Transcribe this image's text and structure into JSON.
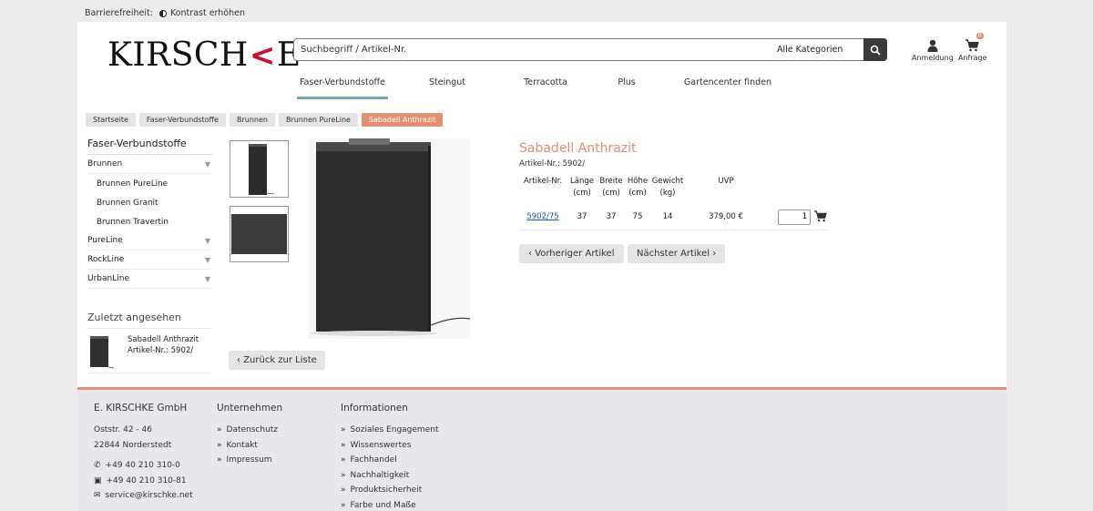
{
  "accessibility": {
    "label": "Barrierefreiheit:",
    "contrast": "Kontrast erhöhen"
  },
  "brand": {
    "part1": "KIRSCH",
    "mark": "<",
    "part2": "E"
  },
  "search": {
    "placeholder": "Suchbegriff / Artikel-Nr.",
    "category": "Alle Kategorien"
  },
  "account": {
    "login": "Anmeldung",
    "cart": "Anfrage",
    "cart_count": "0"
  },
  "nav": [
    {
      "label": "Faser-Verbundstoffe"
    },
    {
      "label": "Steingut"
    },
    {
      "label": "Terracotta"
    },
    {
      "label": "Plus"
    },
    {
      "label": "Gartencenter finden"
    }
  ],
  "breadcrumb": [
    "Startseite",
    "Faser-Verbundstoffe",
    "Brunnen",
    "Brunnen PureLine",
    "Sabadell Anthrazit"
  ],
  "sidebar": {
    "title": "Faser-Verbundstoffe",
    "brunnen": "Brunnen",
    "sub": [
      "Brunnen PureLine",
      "Brunnen Granit",
      "Brunnen Travertin"
    ],
    "pureline": "PureLine",
    "rockline": "RockLine",
    "urbanline": "UrbanLine"
  },
  "recent": {
    "title": "Zuletzt angesehen",
    "name": "Sabadell Anthrazit",
    "art": "Artikel-Nr.: 5902/"
  },
  "gallery": {
    "back": "Zurück zur Liste"
  },
  "product": {
    "title": "Sabadell Anthrazit",
    "art": "Artikel-Nr.: 5902/",
    "headers": [
      "Artikel-Nr.",
      "Länge\n(cm)",
      "Breite\n(cm)",
      "Höhe\n(cm)",
      "Gewicht\n(kg)",
      "UVP"
    ],
    "h_art": "Artikel-Nr.",
    "h_len1": "Länge",
    "h_len2": "(cm)",
    "h_wid1": "Breite",
    "h_wid2": "(cm)",
    "h_hei1": "Höhe",
    "h_hei2": "(cm)",
    "h_wei1": "Gewicht",
    "h_wei2": "(kg)",
    "h_uvp": "UVP",
    "row": {
      "art": "5902/75",
      "len": "37",
      "wid": "37",
      "hei": "75",
      "wei": "14",
      "uvp": "379,00 €",
      "qty": "1"
    },
    "prev": "Vorheriger Artikel",
    "next": "Nächster Artikel"
  },
  "footer": {
    "company": "E. KIRSCHKE GmbH",
    "street": "Oststr. 42 - 46",
    "city": "22844 Norderstedt",
    "phone": "+49 40 210 310-0",
    "fax": "+49 40 210 310-81",
    "email": "service@kirschke.net",
    "col2_title": "Unternehmen",
    "col2": [
      "Datenschutz",
      "Kontakt",
      "Impressum"
    ],
    "col3_title": "Informationen",
    "col3": [
      "Soziales Engagement",
      "Wissenswertes",
      "Fachhandel",
      "Nachhaltigkeit",
      "Produktsicherheit",
      "Farbe und Maße"
    ]
  },
  "colors": {
    "accent": "#e38f74",
    "nav_underline": "#7ba4b6",
    "dark": "#3a3a3a"
  }
}
